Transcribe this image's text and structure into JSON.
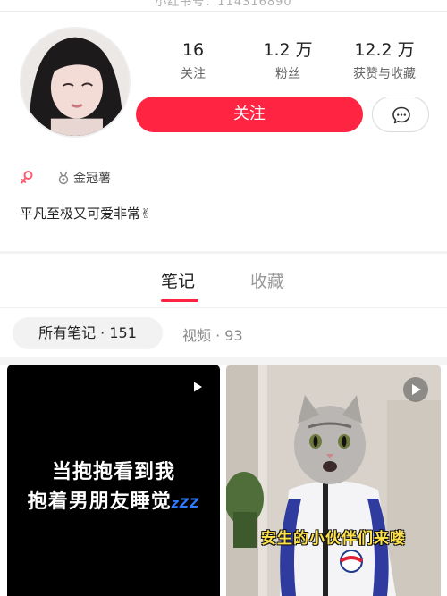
{
  "header_cut": {
    "text": "小红书号：114316890"
  },
  "profile": {
    "stats": [
      {
        "value": "16",
        "label": "关注"
      },
      {
        "value": "1.2 万",
        "label": "粉丝"
      },
      {
        "value": "12.2 万",
        "label": "获赞与收藏"
      }
    ],
    "follow_label": "关注",
    "badge": "金冠薯",
    "bio": "平凡至极又可爱非常✌"
  },
  "tabs": [
    {
      "label": "笔记",
      "active": true
    },
    {
      "label": "收藏",
      "active": false
    }
  ],
  "filters": {
    "all": "所有笔记 · 151",
    "video": "视频 · 93"
  },
  "cards": [
    {
      "line1": "当抱抱看到我",
      "line2": "抱着男朋友睡觉",
      "zzz": "zZZ",
      "icon": "play-icon"
    },
    {
      "caption": "安生的小伙伴们来喽",
      "icon": "play-icon"
    }
  ],
  "colors": {
    "accent": "#ff2442",
    "zzz": "#2f7bff",
    "caption": "#ffe24a"
  }
}
